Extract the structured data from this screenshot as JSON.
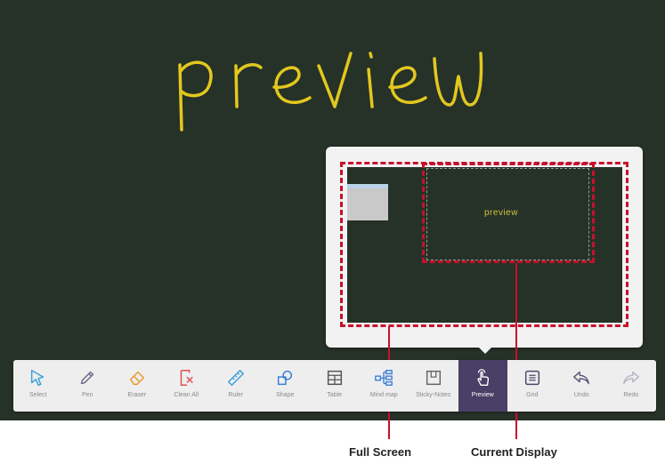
{
  "board": {
    "handwriting_text": "preview"
  },
  "preview_panel": {
    "mini_text": "preview"
  },
  "callouts": {
    "full_screen": "Full Screen",
    "current_display": "Current Display"
  },
  "colors": {
    "board": "#263128",
    "handwriting": "#e2c81e",
    "callout": "#c8102e",
    "toolbar": "#eeeeee",
    "active_tool": "#4a3f66"
  },
  "toolbar": {
    "tools": [
      {
        "id": "select",
        "label": "Select",
        "icon": "cursor-icon"
      },
      {
        "id": "pen",
        "label": "Pen",
        "icon": "pen-icon"
      },
      {
        "id": "eraser",
        "label": "Eraser",
        "icon": "eraser-icon"
      },
      {
        "id": "clear-all",
        "label": "Clean All",
        "icon": "clear-icon"
      },
      {
        "id": "ruler",
        "label": "Ruler",
        "icon": "ruler-icon"
      },
      {
        "id": "shape",
        "label": "Shape",
        "icon": "shape-icon"
      },
      {
        "id": "table",
        "label": "Table",
        "icon": "table-icon"
      },
      {
        "id": "mind-map",
        "label": "Mind map",
        "icon": "mind-map-icon"
      },
      {
        "id": "sticky-notes",
        "label": "Sticky-Notes",
        "icon": "sticky-note-icon"
      },
      {
        "id": "preview",
        "label": "Preview",
        "icon": "touch-hand-icon",
        "active": true
      },
      {
        "id": "grid",
        "label": "Grid",
        "icon": "grid-icon"
      },
      {
        "id": "undo",
        "label": "Undo",
        "icon": "undo-icon"
      },
      {
        "id": "redo",
        "label": "Redo",
        "icon": "redo-icon"
      }
    ]
  }
}
